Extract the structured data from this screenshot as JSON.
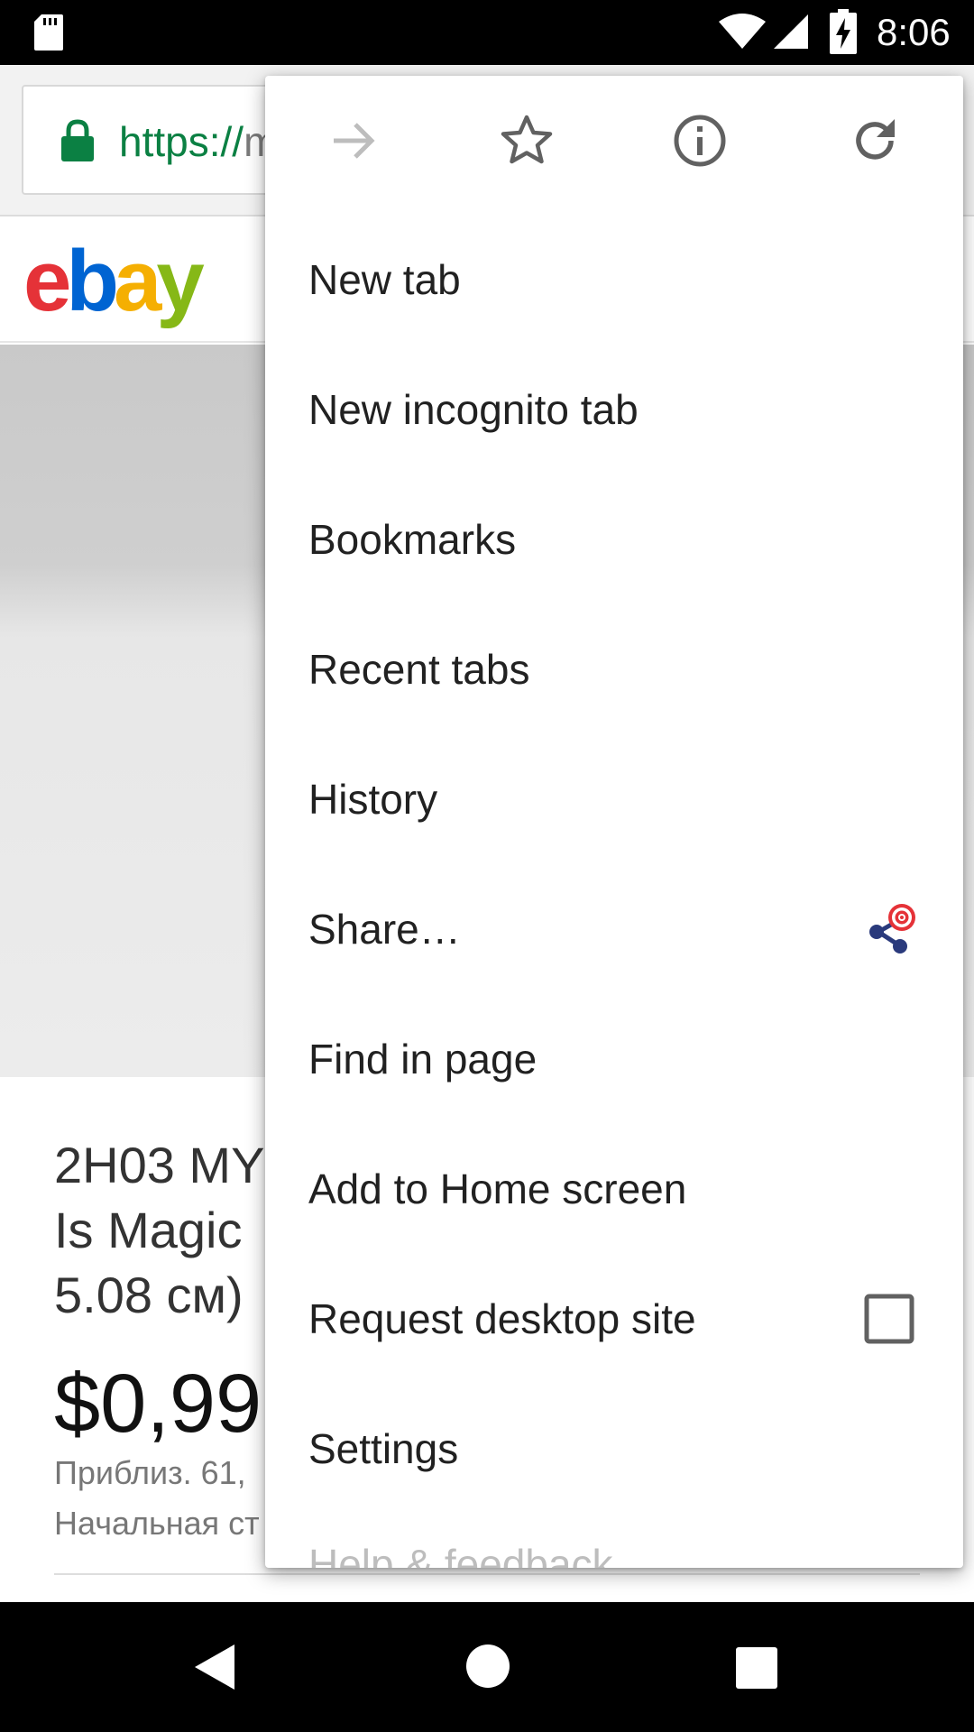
{
  "status_bar": {
    "time": "8:06",
    "icons": [
      "sd-card-icon",
      "wifi-icon",
      "signal-icon",
      "battery-charging-icon"
    ]
  },
  "browser": {
    "url_scheme": "https://",
    "url_rest": "m"
  },
  "page": {
    "logo": {
      "e": "e",
      "b": "b",
      "a": "a",
      "y": "y"
    },
    "product_title": "2H03 MY\nIs Magic\n5.08 см)",
    "price": "$0,99",
    "approx": "Приблиз. 61,",
    "start": "Начальная ст"
  },
  "menu": {
    "top_icons": [
      "forward-icon",
      "bookmark-star-icon",
      "info-icon",
      "reload-icon"
    ],
    "items": [
      {
        "label": "New tab"
      },
      {
        "label": "New incognito tab"
      },
      {
        "label": "Bookmarks"
      },
      {
        "label": "Recent tabs"
      },
      {
        "label": "History"
      },
      {
        "label": "Share…"
      },
      {
        "label": "Find in page"
      },
      {
        "label": "Add to Home screen"
      },
      {
        "label": "Request desktop site"
      },
      {
        "label": "Settings"
      },
      {
        "label": "Help & feedback"
      }
    ]
  },
  "colors": {
    "secure_green": "#0b8043",
    "ebay_red": "#e53238",
    "ebay_blue": "#0064d2",
    "ebay_yellow": "#f5af02",
    "ebay_green": "#86b817",
    "share_target_red": "#e53238",
    "share_node_blue": "#2a3a7c"
  }
}
